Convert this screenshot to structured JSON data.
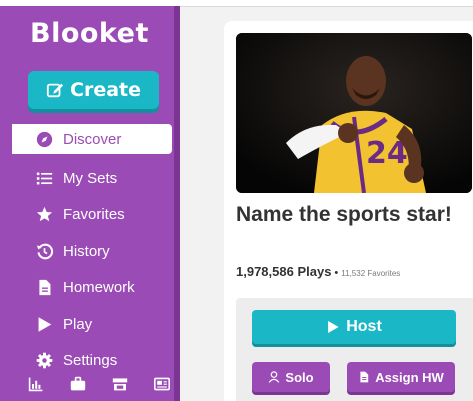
{
  "sidebar": {
    "logo": "Blooket",
    "create_label": "Create",
    "items": [
      {
        "label": "Discover",
        "icon": "compass-icon"
      },
      {
        "label": "My Sets",
        "icon": "list-icon"
      },
      {
        "label": "Favorites",
        "icon": "star-icon"
      },
      {
        "label": "History",
        "icon": "history-icon"
      },
      {
        "label": "Homework",
        "icon": "document-icon"
      },
      {
        "label": "Play",
        "icon": "play-icon"
      },
      {
        "label": "Settings",
        "icon": "gear-icon"
      }
    ],
    "bottom_icons": [
      "chart-icon",
      "briefcase-icon",
      "store-icon",
      "news-icon"
    ]
  },
  "set": {
    "title": "Name the sports star!",
    "plays": "1,978,586 Plays",
    "separator": "•",
    "favorites": "11,532 Favorites",
    "host_label": "Host",
    "solo_label": "Solo",
    "assign_label": "Assign HW"
  },
  "colors": {
    "sidebar": "#9b4bb5",
    "accent": "#1ab7c7"
  }
}
